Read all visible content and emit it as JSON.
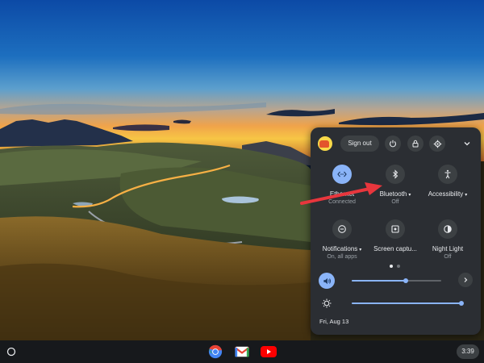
{
  "quick_settings": {
    "sign_out_label": "Sign out",
    "tiles": [
      {
        "label": "Ethernet",
        "sub": "Connected",
        "icon": "ethernet-icon",
        "active": true,
        "has_menu": false
      },
      {
        "label": "Bluetooth",
        "sub": "Off",
        "icon": "bluetooth-icon",
        "active": false,
        "has_menu": true
      },
      {
        "label": "Accessibility",
        "sub": "",
        "icon": "accessibility-icon",
        "active": false,
        "has_menu": true
      },
      {
        "label": "Notifications",
        "sub": "On, all apps",
        "icon": "notifications-icon",
        "active": false,
        "has_menu": true
      },
      {
        "label": "Screen captu...",
        "sub": "",
        "icon": "screen-capture-icon",
        "active": false,
        "has_menu": false
      },
      {
        "label": "Night Light",
        "sub": "Off",
        "icon": "night-light-icon",
        "active": false,
        "has_menu": false
      }
    ],
    "pagination": {
      "pages": 2,
      "current": 1
    },
    "volume_level": 0.6,
    "brightness_level": 1.0,
    "date": "Fri, Aug 13"
  },
  "shelf": {
    "apps": [
      "chrome-icon",
      "gmail-icon",
      "youtube-icon"
    ],
    "time": "3:39"
  },
  "colors": {
    "panel": "#2b2e33",
    "accent": "#8ab4f8",
    "annotation": "#e8363d",
    "shelf": "#17191c"
  }
}
